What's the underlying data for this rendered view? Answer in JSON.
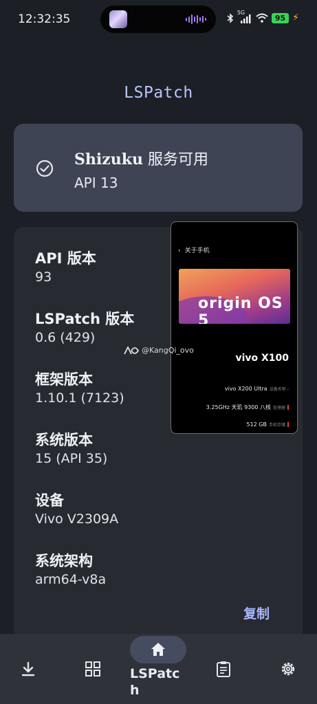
{
  "status_bar": {
    "time": "12:32:35",
    "network": "5G",
    "battery": "95",
    "icons": [
      "bluetooth-icon",
      "signal-icon",
      "wifi-icon",
      "battery-icon",
      "charging-bolt-icon"
    ]
  },
  "app": {
    "title": "LSPatch"
  },
  "status_card": {
    "brand": "Shizuku",
    "status_text": " 服务可用",
    "api": "API 13",
    "icon": "check-circle-icon"
  },
  "info": {
    "items": [
      {
        "label": "API 版本",
        "value": "93"
      },
      {
        "label": "LSPatch 版本",
        "value": "0.6 (429)"
      },
      {
        "label": "框架版本",
        "value": "1.10.1 (7123)"
      },
      {
        "label": "系统版本",
        "value": "15 (API 35)"
      },
      {
        "label": "设备",
        "value": "Vivo V2309A"
      },
      {
        "label": "系统架构",
        "value": "arm64-v8a"
      }
    ],
    "copy_label": "复制"
  },
  "overlay": {
    "back": "‹",
    "header": "关于手机",
    "logo": "origin OS 5",
    "model": "vivo X100",
    "rows": [
      {
        "value": "vivo X200 Ultra",
        "sub": "设备名称 ›"
      },
      {
        "value": "3.25GHz 天玑 9300 八核",
        "sub": "处理器"
      },
      {
        "value": "512 GB",
        "sub": "手机存储"
      }
    ]
  },
  "watermark": {
    "text": "@KangQi_ovo"
  },
  "nav": {
    "items": [
      {
        "name": "download",
        "icon": "download-icon"
      },
      {
        "name": "modules",
        "icon": "grid-icon"
      },
      {
        "name": "home",
        "icon": "home-icon",
        "label": "LSPatch",
        "active": true
      },
      {
        "name": "logs",
        "icon": "clipboard-icon"
      },
      {
        "name": "settings",
        "icon": "gear-icon"
      }
    ]
  },
  "colors": {
    "background": "#1c1f25",
    "status_card": "#3e4454",
    "info_card": "#272a31",
    "accent": "#a9b7ff",
    "title": "#b9c6ff",
    "nav_bar": "#2f3339",
    "nav_active_pill": "#454c60"
  }
}
